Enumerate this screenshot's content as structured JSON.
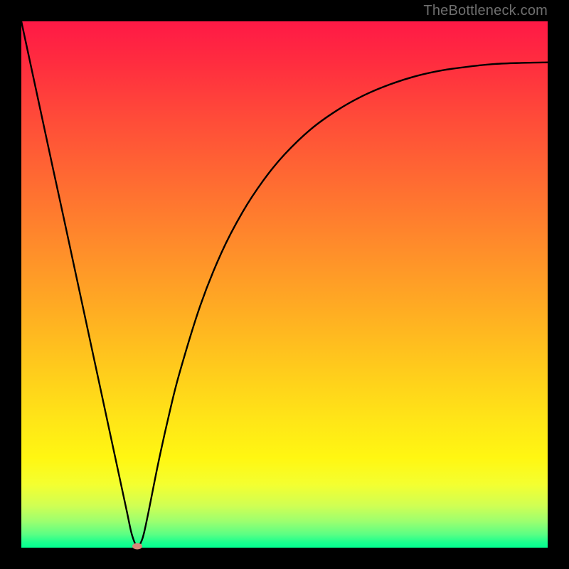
{
  "attribution": "TheBottleneck.com",
  "colors": {
    "frame": "#000000",
    "curve": "#000000",
    "marker": "#d88879",
    "gradient_top": "#ff1946",
    "gradient_bottom": "#02ff90",
    "attribution_text": "#6f6f6f"
  },
  "chart_data": {
    "type": "line",
    "title": "",
    "xlabel": "",
    "ylabel": "",
    "xlim": [
      0,
      100
    ],
    "ylim": [
      0,
      100
    ],
    "series": [
      {
        "name": "bottleneck-curve",
        "x": [
          0,
          2,
          4,
          6,
          8,
          10,
          12,
          14,
          16,
          18,
          20,
          21,
          22,
          23,
          24,
          26,
          28,
          30,
          34,
          38,
          42,
          46,
          50,
          55,
          60,
          65,
          70,
          75,
          80,
          85,
          90,
          95,
          100
        ],
        "values": [
          100,
          90.7,
          81.4,
          72.1,
          62.9,
          53.6,
          44.3,
          35.0,
          25.7,
          16.4,
          7.1,
          2.5,
          0.3,
          1.7,
          6.0,
          16.0,
          25.0,
          33.0,
          46.0,
          56.0,
          63.7,
          69.8,
          74.7,
          79.5,
          83.1,
          85.9,
          88.0,
          89.6,
          90.7,
          91.4,
          91.9,
          92.1,
          92.2
        ]
      }
    ],
    "annotations": [
      {
        "name": "min-marker",
        "x": 22,
        "y": 0.3
      }
    ],
    "grid": false,
    "legend": false
  }
}
